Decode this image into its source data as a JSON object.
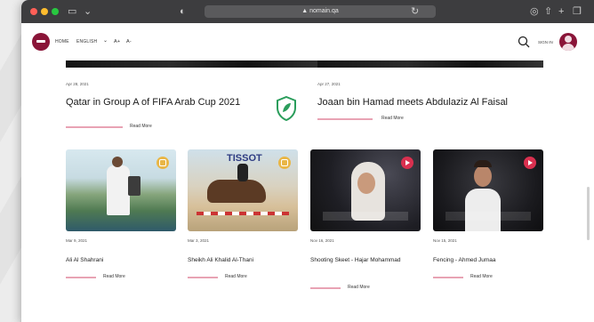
{
  "browser": {
    "address": "▲ nomain.qa"
  },
  "nav": {
    "home": "HOME",
    "language": "ENGLISH",
    "font_a_plus": "A+",
    "font_a_minus": "A-",
    "signin": "SIGN IN"
  },
  "featured": [
    {
      "date": "Apr 28, 2021",
      "title": "Qatar in Group A of FIFA Arab Cup 2021",
      "read_more": "Read More"
    },
    {
      "date": "Apr 27, 2021",
      "title": "Joaan bin Hamad meets Abdulaziz Al Faisal",
      "read_more": "Read More"
    }
  ],
  "cards": [
    {
      "date": "Mar 9, 2021",
      "title": "Ali Al Shahrani",
      "read_more": "Read More",
      "media": "photo-badge"
    },
    {
      "date": "Mar 3, 2021",
      "title": "Sheikh Ali Khalid Al-Thani",
      "read_more": "Read More",
      "media": "photo-badge",
      "sign_text": "TISSOT"
    },
    {
      "date": "Nov 16, 2021",
      "title": "Shooting Skeet - Hajar Mohammad",
      "read_more": "Read More",
      "media": "video-badge"
    },
    {
      "date": "Nov 15, 2021",
      "title": "Fencing - Ahmed Jumaa",
      "read_more": "Read More",
      "media": "video-badge"
    }
  ],
  "colors": {
    "brand": "#8a1538",
    "accent_line": "#e8a3b4",
    "video_badge": "#d9304f",
    "photo_badge": "#e9b646"
  },
  "icons": [
    "search-icon",
    "chevron-down-icon",
    "shield-logo-icon",
    "play-icon",
    "gallery-icon"
  ]
}
